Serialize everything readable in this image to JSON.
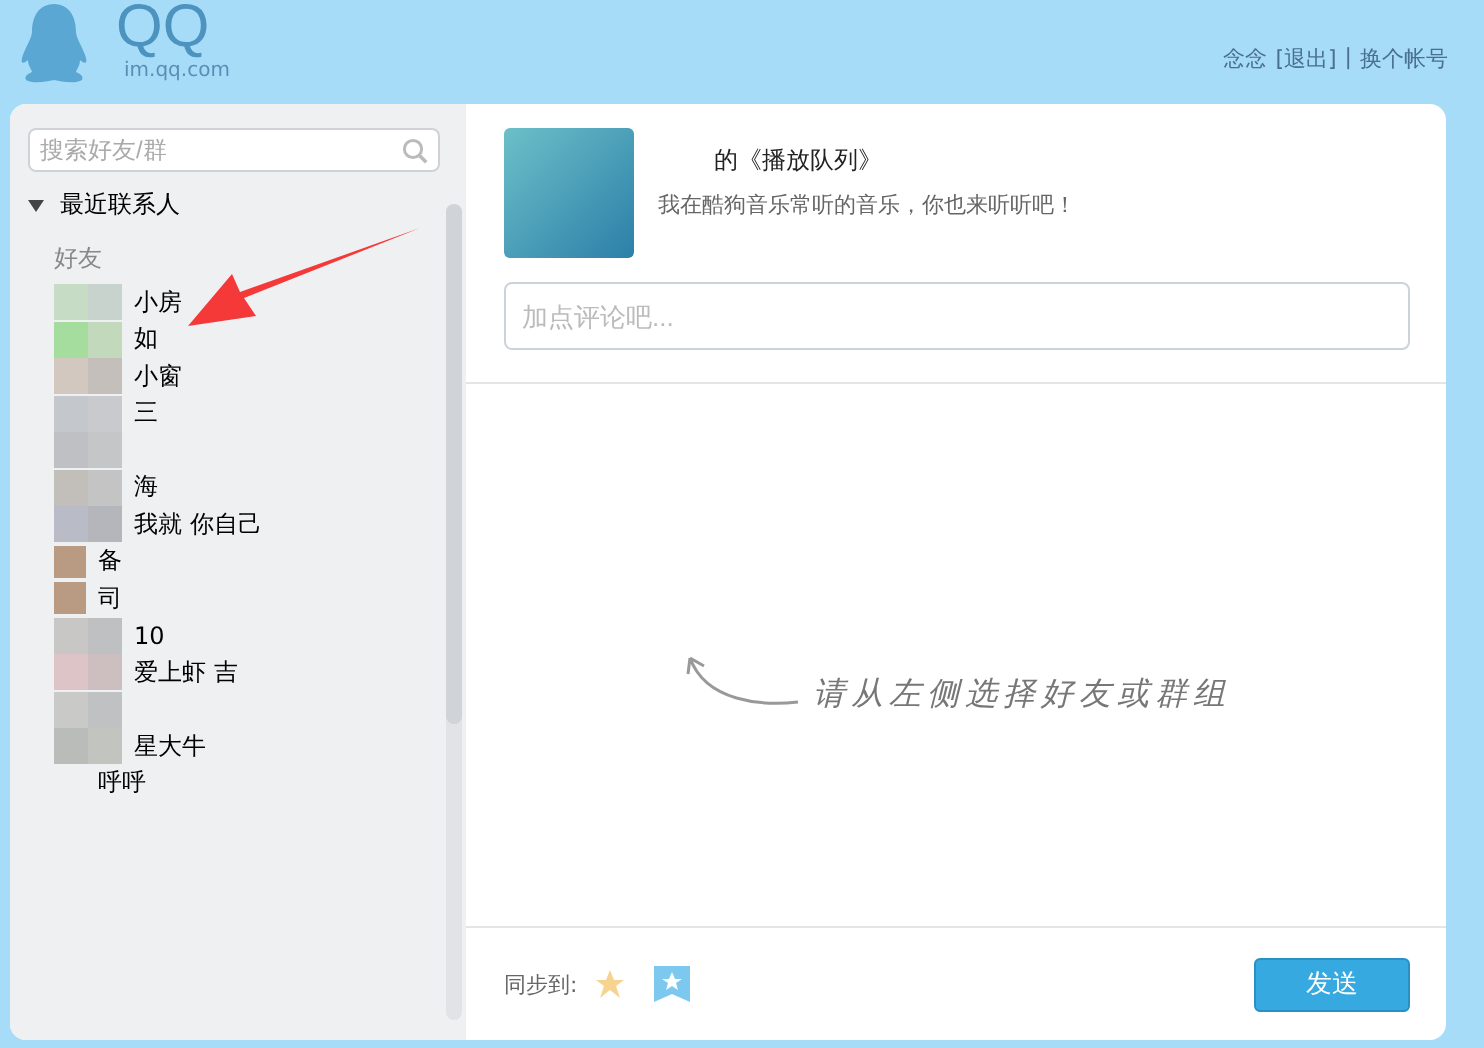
{
  "logo": {
    "name": "QQ",
    "domain": "im.qq.com"
  },
  "account": {
    "user": "念念",
    "logout": "[退出]",
    "separator": "|",
    "switch": "换个帐号"
  },
  "sidebar": {
    "search": {
      "placeholder": "搜索好友/群"
    },
    "section": {
      "label": "最近联系人",
      "expanded": true
    },
    "group": "好友",
    "contacts": [
      {
        "name": "小房",
        "kind": "blurred"
      },
      {
        "name": "如",
        "kind": "blurred"
      },
      {
        "name": "小窗",
        "kind": "blurred"
      },
      {
        "name": "三",
        "kind": "blurred"
      },
      {
        "kind": "blurred"
      },
      {
        "name": "海",
        "kind": "blurred"
      },
      {
        "name": "我就        你自己",
        "kind": "blurred"
      },
      {
        "name": "备",
        "kind": "photo"
      },
      {
        "name": "司",
        "kind": "photo"
      },
      {
        "name": "10",
        "kind": "blurred"
      },
      {
        "name": "爱上虾          吉",
        "kind": "blurred"
      },
      {
        "kind": "blurred"
      },
      {
        "name": "星大牛",
        "kind": "blurred"
      },
      {
        "name": "呼呼",
        "kind": "plain"
      }
    ]
  },
  "share": {
    "title": "的《播放队列》",
    "text": "我在酷狗音乐常听的音乐，你也来听听吧！",
    "comment": {
      "placeholder": "加点评论吧..."
    }
  },
  "hint": "请从左侧选择好友或群组",
  "footer": {
    "sync_label": "同步到:",
    "send": "发送"
  }
}
